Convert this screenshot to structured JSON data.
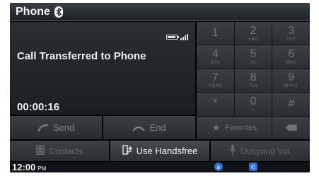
{
  "header": {
    "title": "Phone",
    "bluetooth_symbol": "ʙ"
  },
  "call": {
    "status": "Call Transferred to Phone",
    "timer": "00:00:16",
    "send_label": "Send",
    "end_label": "End"
  },
  "keypad": {
    "keys": [
      {
        "digit": "1",
        "letters": ""
      },
      {
        "digit": "2",
        "letters": "ABC"
      },
      {
        "digit": "3",
        "letters": "DEF"
      },
      {
        "digit": "4",
        "letters": "GHI"
      },
      {
        "digit": "5",
        "letters": "JKL"
      },
      {
        "digit": "6",
        "letters": "MNO"
      },
      {
        "digit": "7",
        "letters": "PQRS"
      },
      {
        "digit": "8",
        "letters": "TUV"
      },
      {
        "digit": "9",
        "letters": "WXYZ"
      },
      {
        "digit": "*",
        "letters": ""
      },
      {
        "digit": "0",
        "letters": "+"
      },
      {
        "digit": "#",
        "letters": ""
      }
    ],
    "favorites_label": "Favorites"
  },
  "bottom": {
    "contacts_label": "Contacts",
    "use_handsfree_label": "Use Handsfree",
    "outgoing_vol_label": "Outgoing Vol."
  },
  "status_bar": {
    "time": "12:00",
    "ampm": "PM"
  },
  "colors": {
    "accent_blue": "#2f6fd6",
    "active_text": "#f2f2f2",
    "disabled_text": "#6e737a"
  }
}
